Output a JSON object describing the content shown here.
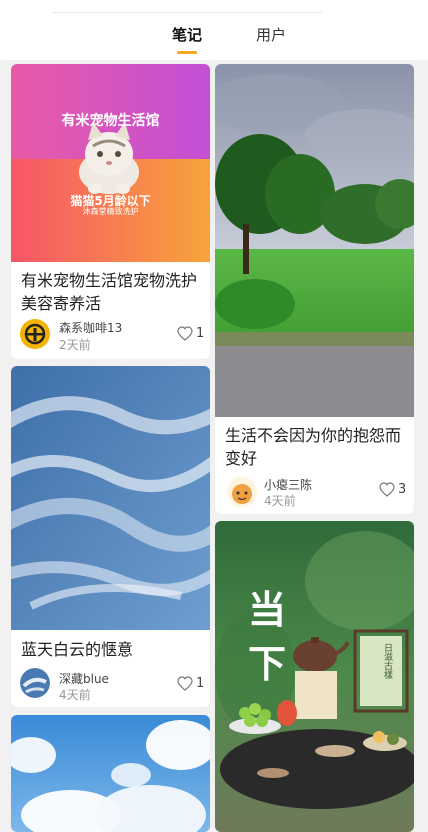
{
  "tabs": [
    {
      "label": "笔记",
      "active": true
    },
    {
      "label": "用户",
      "active": false
    }
  ],
  "accent_color": "#f5a623",
  "cards": [
    {
      "title": "有米宠物生活馆宠物洗护美容寄养活",
      "image_text": {
        "headline": "有米宠物生活馆",
        "promo": "猫猫5月龄以下",
        "promo_sub": "沐森堂精致洗护"
      },
      "author": "森系咖啡13",
      "time": "2天前",
      "likes": "1",
      "avatar_icon": "coffee-logo-icon"
    },
    {
      "title": "生活不会因为你的抱怨而变好",
      "author": "小瘪三陈",
      "time": "4天前",
      "likes": "3",
      "avatar_icon": "cartoon-avatar"
    },
    {
      "title": "蓝天白云的惬意",
      "author": "深藏blue",
      "time": "4天前",
      "likes": "1",
      "avatar_icon": "cloud-avatar"
    },
    {
      "image_text": {
        "big_char_1": "当",
        "big_char_2": "下",
        "sign": "日滋古樣"
      }
    },
    {}
  ]
}
